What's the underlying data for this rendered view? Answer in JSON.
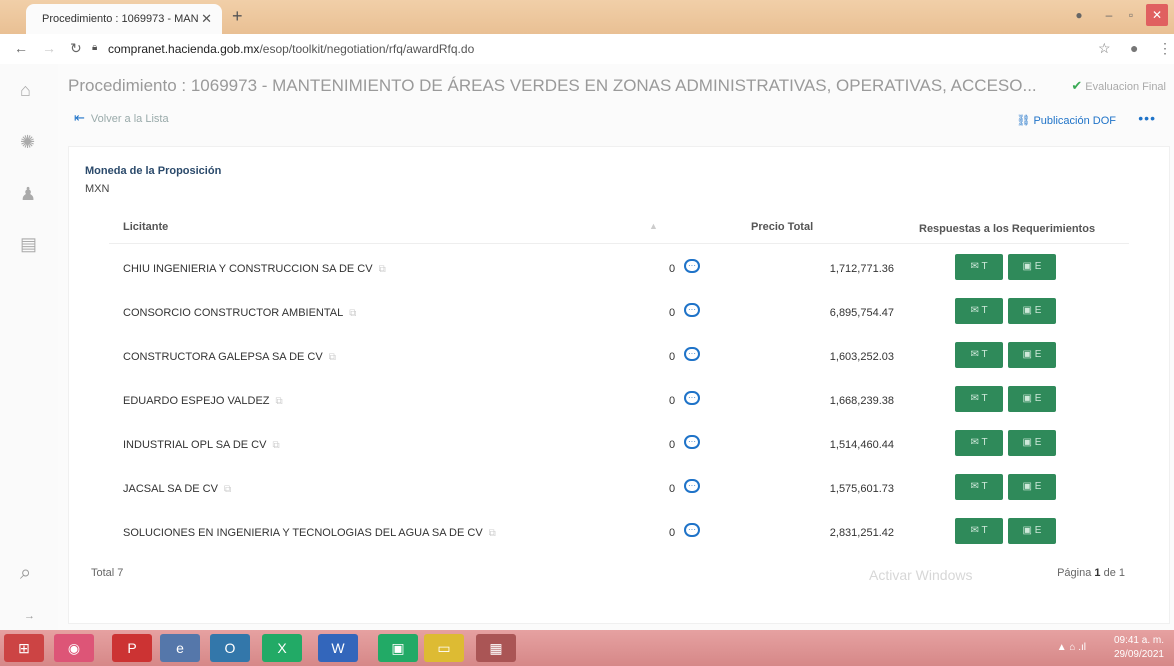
{
  "browser": {
    "tab_title": "Procedimiento : 1069973 - MAN",
    "url_host": "compranet.hacienda.gob.mx",
    "url_path": "/esop/toolkit/negotiation/rfq/awardRfq.do"
  },
  "page": {
    "title": "Procedimiento : 1069973 - MANTENIMIENTO DE ÁREAS VERDES EN ZONAS ADMINISTRATIVAS, OPERATIVAS, ACCESO...",
    "status": "Evaluacion Final",
    "back_label": "Volver a la Lista",
    "publication_label": "Publicación DOF"
  },
  "currency": {
    "label": "Moneda de la Proposición",
    "value": "MXN"
  },
  "table": {
    "headers": {
      "bidder": "Licitante",
      "total_price": "Precio Total",
      "responses": "Respuestas a los Requerimientos"
    },
    "rows": [
      {
        "name": "CHIU INGENIERIA Y CONSTRUCCION SA DE CV",
        "count": "0",
        "price": "1,712,771.36",
        "btn_t": "T",
        "btn_e": "E"
      },
      {
        "name": "CONSORCIO CONSTRUCTOR AMBIENTAL",
        "count": "0",
        "price": "6,895,754.47",
        "btn_t": "T",
        "btn_e": "E"
      },
      {
        "name": "CONSTRUCTORA GALEPSA SA DE CV",
        "count": "0",
        "price": "1,603,252.03",
        "btn_t": "T",
        "btn_e": "E"
      },
      {
        "name": "EDUARDO ESPEJO VALDEZ",
        "count": "0",
        "price": "1,668,239.38",
        "btn_t": "T",
        "btn_e": "E"
      },
      {
        "name": "INDUSTRIAL OPL SA DE CV",
        "count": "0",
        "price": "1,514,460.44",
        "btn_t": "T",
        "btn_e": "E"
      },
      {
        "name": "JACSAL SA DE CV",
        "count": "0",
        "price": "1,575,601.73",
        "btn_t": "T",
        "btn_e": "E"
      },
      {
        "name": "SOLUCIONES EN INGENIERIA Y TECNOLOGIAS DEL AGUA SA DE CV",
        "count": "0",
        "price": "2,831,251.42",
        "btn_t": "T",
        "btn_e": "E"
      }
    ],
    "total_label": "Total 7",
    "pager_prefix": "Página",
    "pager_current": "1",
    "pager_of": "de 1"
  },
  "watermark": "Activar Windows",
  "taskbar": {
    "time": "09:41 a. m.",
    "date": "29/09/2021"
  }
}
